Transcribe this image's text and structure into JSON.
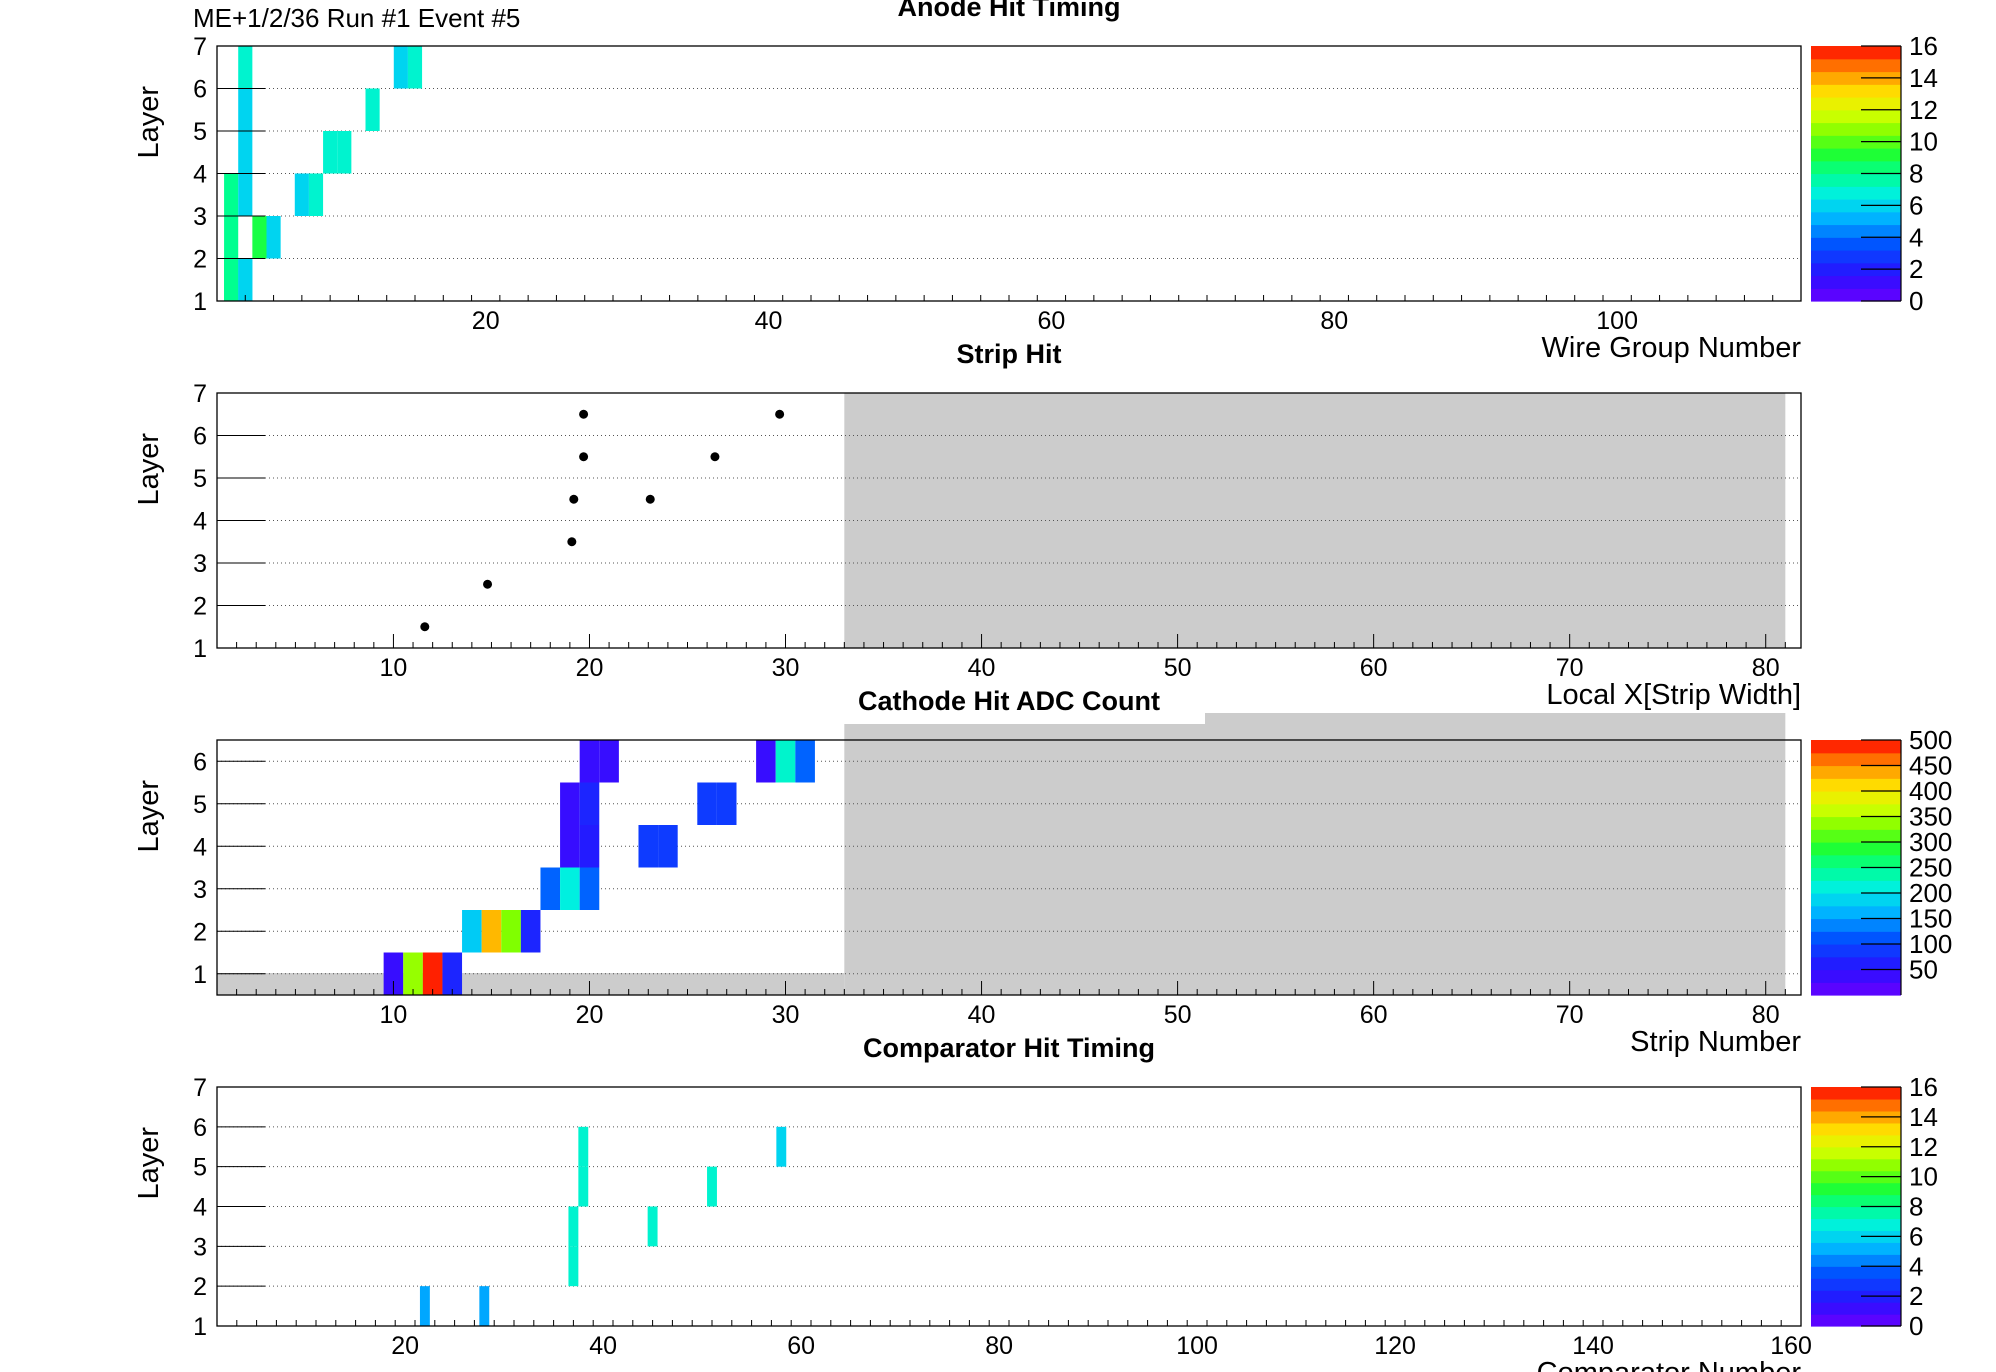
{
  "header": "ME+1/2/36   Run #1   Event #5",
  "ylabel": "Layer",
  "chart_data": [
    {
      "type": "heatmap",
      "title": "Anode Hit Timing",
      "xlabel": "Wire Group Number",
      "ylabel": "Layer",
      "xlim": [
        1,
        113
      ],
      "ylim": [
        1,
        7
      ],
      "xticks": [
        20,
        40,
        60,
        80,
        100
      ],
      "yticks": [
        1,
        2,
        3,
        4,
        5,
        6,
        7
      ],
      "colorbar": {
        "min": 0,
        "max": 16,
        "ticks": [
          0,
          2,
          4,
          6,
          8,
          10,
          12,
          14,
          16
        ]
      },
      "cells": [
        {
          "x": 2,
          "layer": 1,
          "value": 8
        },
        {
          "x": 3,
          "layer": 1,
          "value": 6
        },
        {
          "x": 2,
          "layer": 2,
          "value": 8
        },
        {
          "x": 3,
          "layer": 2,
          "value": 6
        },
        {
          "x": 2,
          "layer": 3,
          "value": 8
        },
        {
          "x": 4,
          "layer": 3,
          "value": 9
        },
        {
          "x": 5,
          "layer": 3,
          "value": 6
        },
        {
          "x": 2,
          "layer": 4,
          "value": 8
        },
        {
          "x": 7,
          "layer": 4,
          "value": 6
        },
        {
          "x": 8,
          "layer": 4,
          "value": 7
        },
        {
          "x": 3,
          "layer": 4,
          "value": 6
        },
        {
          "x": 3,
          "layer": 5,
          "value": 6
        },
        {
          "x": 9,
          "layer": 5,
          "value": 7
        },
        {
          "x": 10,
          "layer": 5,
          "value": 7
        },
        {
          "x": 3,
          "layer": 6,
          "value": 6
        },
        {
          "x": 12,
          "layer": 6,
          "value": 7
        },
        {
          "x": 3,
          "layer": 7,
          "value": 7
        },
        {
          "x": 14,
          "layer": 7,
          "value": 6
        },
        {
          "x": 15,
          "layer": 7,
          "value": 7
        }
      ]
    },
    {
      "type": "scatter",
      "title": "Strip Hit",
      "xlabel": "Local X[Strip Width]",
      "ylabel": "Layer",
      "xlim": [
        1,
        81.8
      ],
      "ylim": [
        1,
        7
      ],
      "xticks": [
        10,
        20,
        30,
        40,
        50,
        60,
        70,
        80
      ],
      "yticks": [
        1,
        2,
        3,
        4,
        5,
        6,
        7
      ],
      "inactive_region": {
        "x": [
          33,
          81
        ]
      },
      "points": [
        {
          "x": 11.6,
          "y": 1.5
        },
        {
          "x": 14.8,
          "y": 2.5
        },
        {
          "x": 19.1,
          "y": 3.5
        },
        {
          "x": 19.2,
          "y": 4.5
        },
        {
          "x": 23.1,
          "y": 4.5
        },
        {
          "x": 19.7,
          "y": 5.5
        },
        {
          "x": 26.4,
          "y": 5.5
        },
        {
          "x": 19.7,
          "y": 6.5
        },
        {
          "x": 29.7,
          "y": 6.5
        }
      ]
    },
    {
      "type": "heatmap",
      "title": "Cathode Hit ADC Count",
      "xlabel": "Strip Number",
      "ylabel": "Layer",
      "xlim": [
        1,
        81.8
      ],
      "ylim": [
        0.5,
        6.5
      ],
      "xticks": [
        10,
        20,
        30,
        40,
        50,
        60,
        70,
        80
      ],
      "yticks": [
        1,
        2,
        3,
        4,
        5,
        6
      ],
      "inactive_region": {
        "x": [
          33,
          81
        ]
      },
      "colorbar": {
        "min": 0,
        "max": 500,
        "ticks": [
          50,
          100,
          150,
          200,
          250,
          300,
          350,
          400,
          450,
          500
        ]
      },
      "cells": [
        {
          "x": 10,
          "layer": 1,
          "value": 40
        },
        {
          "x": 11,
          "layer": 1,
          "value": 340
        },
        {
          "x": 12,
          "layer": 1,
          "value": 490
        },
        {
          "x": 13,
          "layer": 1,
          "value": 70
        },
        {
          "x": 14,
          "layer": 2,
          "value": 180
        },
        {
          "x": 15,
          "layer": 2,
          "value": 430
        },
        {
          "x": 16,
          "layer": 2,
          "value": 330
        },
        {
          "x": 17,
          "layer": 2,
          "value": 70
        },
        {
          "x": 18,
          "layer": 3,
          "value": 120
        },
        {
          "x": 19,
          "layer": 3,
          "value": 210
        },
        {
          "x": 20,
          "layer": 3,
          "value": 120
        },
        {
          "x": 19,
          "layer": 4,
          "value": 40
        },
        {
          "x": 20,
          "layer": 4,
          "value": 60
        },
        {
          "x": 23,
          "layer": 4,
          "value": 90
        },
        {
          "x": 24,
          "layer": 4,
          "value": 90
        },
        {
          "x": 19,
          "layer": 5,
          "value": 40
        },
        {
          "x": 20,
          "layer": 5,
          "value": 70
        },
        {
          "x": 26,
          "layer": 5,
          "value": 90
        },
        {
          "x": 27,
          "layer": 5,
          "value": 90
        },
        {
          "x": 20,
          "layer": 6,
          "value": 40
        },
        {
          "x": 21,
          "layer": 6,
          "value": 40
        },
        {
          "x": 29,
          "layer": 6,
          "value": 40
        },
        {
          "x": 30,
          "layer": 6,
          "value": 220
        },
        {
          "x": 31,
          "layer": 6,
          "value": 120
        }
      ]
    },
    {
      "type": "heatmap",
      "title": "Comparator Hit Timing",
      "xlabel": "Comparator Number",
      "ylabel": "Layer",
      "xlim": [
        1,
        161
      ],
      "ylim": [
        1,
        7
      ],
      "xticks": [
        20,
        40,
        60,
        80,
        100,
        120,
        140,
        160
      ],
      "yticks": [
        1,
        2,
        3,
        4,
        5,
        6,
        7
      ],
      "colorbar": {
        "min": 0,
        "max": 16,
        "ticks": [
          0,
          2,
          4,
          6,
          8,
          10,
          12,
          14,
          16
        ]
      },
      "cells": [
        {
          "x": 22,
          "layer": 1,
          "value": 5
        },
        {
          "x": 28,
          "layer": 2,
          "value": 5
        },
        {
          "x": 37,
          "layer": 3,
          "value": 7
        },
        {
          "x": 37,
          "layer": 4,
          "value": 7
        },
        {
          "x": 45,
          "layer": 4,
          "value": 7
        },
        {
          "x": 38,
          "layer": 5,
          "value": 7
        },
        {
          "x": 51,
          "layer": 5,
          "value": 7
        },
        {
          "x": 38,
          "layer": 6,
          "value": 7
        },
        {
          "x": 58,
          "layer": 6,
          "value": 6
        }
      ]
    }
  ]
}
